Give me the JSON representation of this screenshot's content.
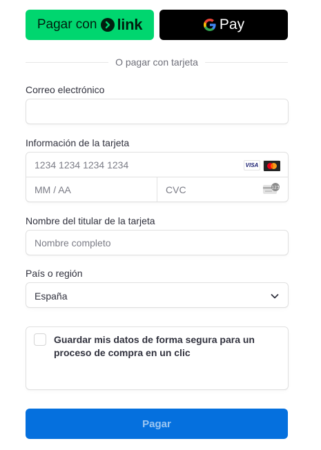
{
  "express": {
    "link_prefix": "Pagar con",
    "link_brand": "link",
    "gpay_label": "Pay"
  },
  "divider_text": "O pagar con tarjeta",
  "email": {
    "label": "Correo electrónico",
    "value": "",
    "placeholder": ""
  },
  "card": {
    "label": "Información de la tarjeta",
    "number_placeholder": "1234 1234 1234 1234",
    "expiry_placeholder": "MM / AA",
    "cvc_placeholder": "CVC",
    "visa_label": "VISA"
  },
  "cardholder": {
    "label": "Nombre del titular de la tarjeta",
    "placeholder": "Nombre completo"
  },
  "country": {
    "label": "País o región",
    "selected": "España"
  },
  "save": {
    "text": "Guardar mis datos de forma segura para un proceso de compra en un clic",
    "checked": false
  },
  "pay_button": {
    "label": "Pagar"
  },
  "colors": {
    "link_green": "#00d66f",
    "pay_blue": "#0570de",
    "gpay_black": "#000000"
  },
  "icons": [
    "arrow-right-icon",
    "google-g-icon",
    "visa-icon",
    "mastercard-icon",
    "cvc-card-icon",
    "chevron-down-icon"
  ]
}
